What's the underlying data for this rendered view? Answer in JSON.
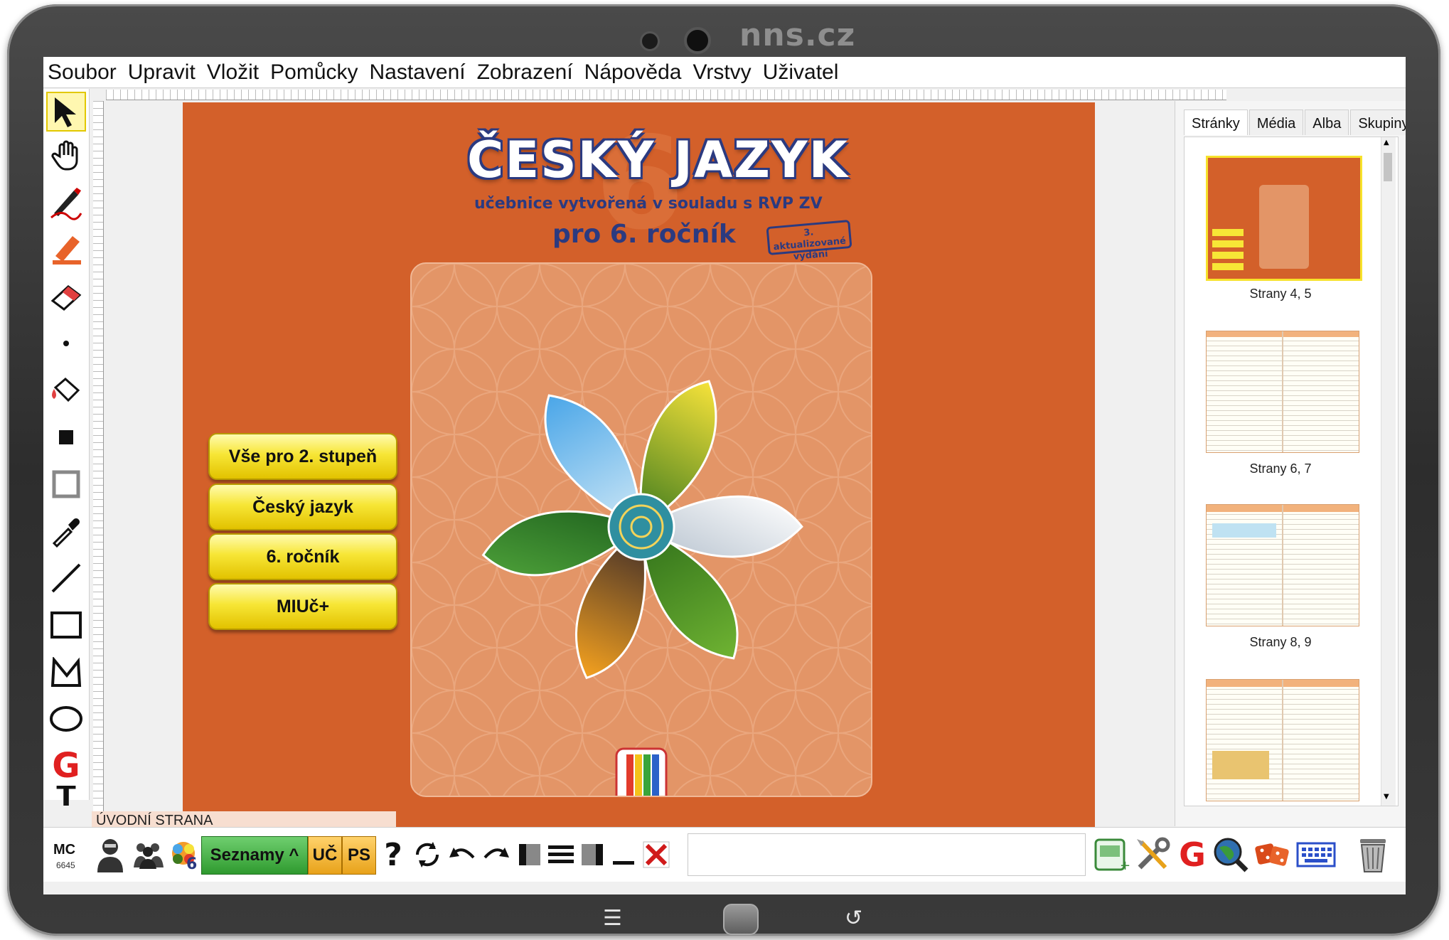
{
  "brand": "nns.cz",
  "menu": [
    "Soubor",
    "Upravit",
    "Vložit",
    "Pomůcky",
    "Nastavení",
    "Zobrazení",
    "Nápověda",
    "Vrstvy",
    "Uživatel"
  ],
  "tools": [
    {
      "name": "arrow-icon",
      "glyph": "➤"
    },
    {
      "name": "hand-icon",
      "glyph": "✋"
    },
    {
      "name": "pen-icon",
      "glyph": "✎"
    },
    {
      "name": "highlighter-icon",
      "glyph": "✐"
    },
    {
      "name": "eraser-icon",
      "glyph": "▱"
    },
    {
      "name": "dot-icon",
      "glyph": "•"
    },
    {
      "name": "fill-bucket-icon",
      "glyph": "⛉"
    },
    {
      "name": "filled-square-icon",
      "glyph": "■"
    },
    {
      "name": "outline-square-icon",
      "glyph": "▣"
    },
    {
      "name": "eyedropper-icon",
      "glyph": "✏"
    },
    {
      "name": "line-icon",
      "glyph": "╱"
    },
    {
      "name": "rectangle-icon",
      "glyph": "□"
    },
    {
      "name": "polygon-icon",
      "glyph": "⛛"
    },
    {
      "name": "ellipse-icon",
      "glyph": "○"
    },
    {
      "name": "geogebra-icon",
      "glyph": "G"
    },
    {
      "name": "text-icon",
      "glyph": "T"
    }
  ],
  "cover": {
    "title": "ČESKÝ JAZYK",
    "big_number": "6",
    "subtitle": "učebnice vytvořená v souladu s RVP ZV",
    "grade": "pro 6. ročník",
    "stamp": "3. aktualizované vydání",
    "buttons": [
      "Vše pro 2. stupeň",
      "Český jazyk",
      "6. ročník",
      "MIUč+"
    ],
    "page_label": "ÚVODNÍ STRANA",
    "publisher_logo": "nns.cz"
  },
  "right_panel": {
    "tabs": [
      "Stránky",
      "Média",
      "Alba",
      "Skupiny"
    ],
    "thumbs": [
      "Strany 4, 5",
      "Strany 6, 7",
      "Strany 8, 9"
    ]
  },
  "bottom": {
    "mc": "MC",
    "mc_code": "6645",
    "seznamy": "Seznamy ^",
    "uc": "UČ",
    "ps": "PS",
    "help": "?"
  },
  "colors": {
    "page_bg": "#d3602a",
    "title_stroke": "#2b3a80",
    "button_yellow": "#f7e636"
  }
}
